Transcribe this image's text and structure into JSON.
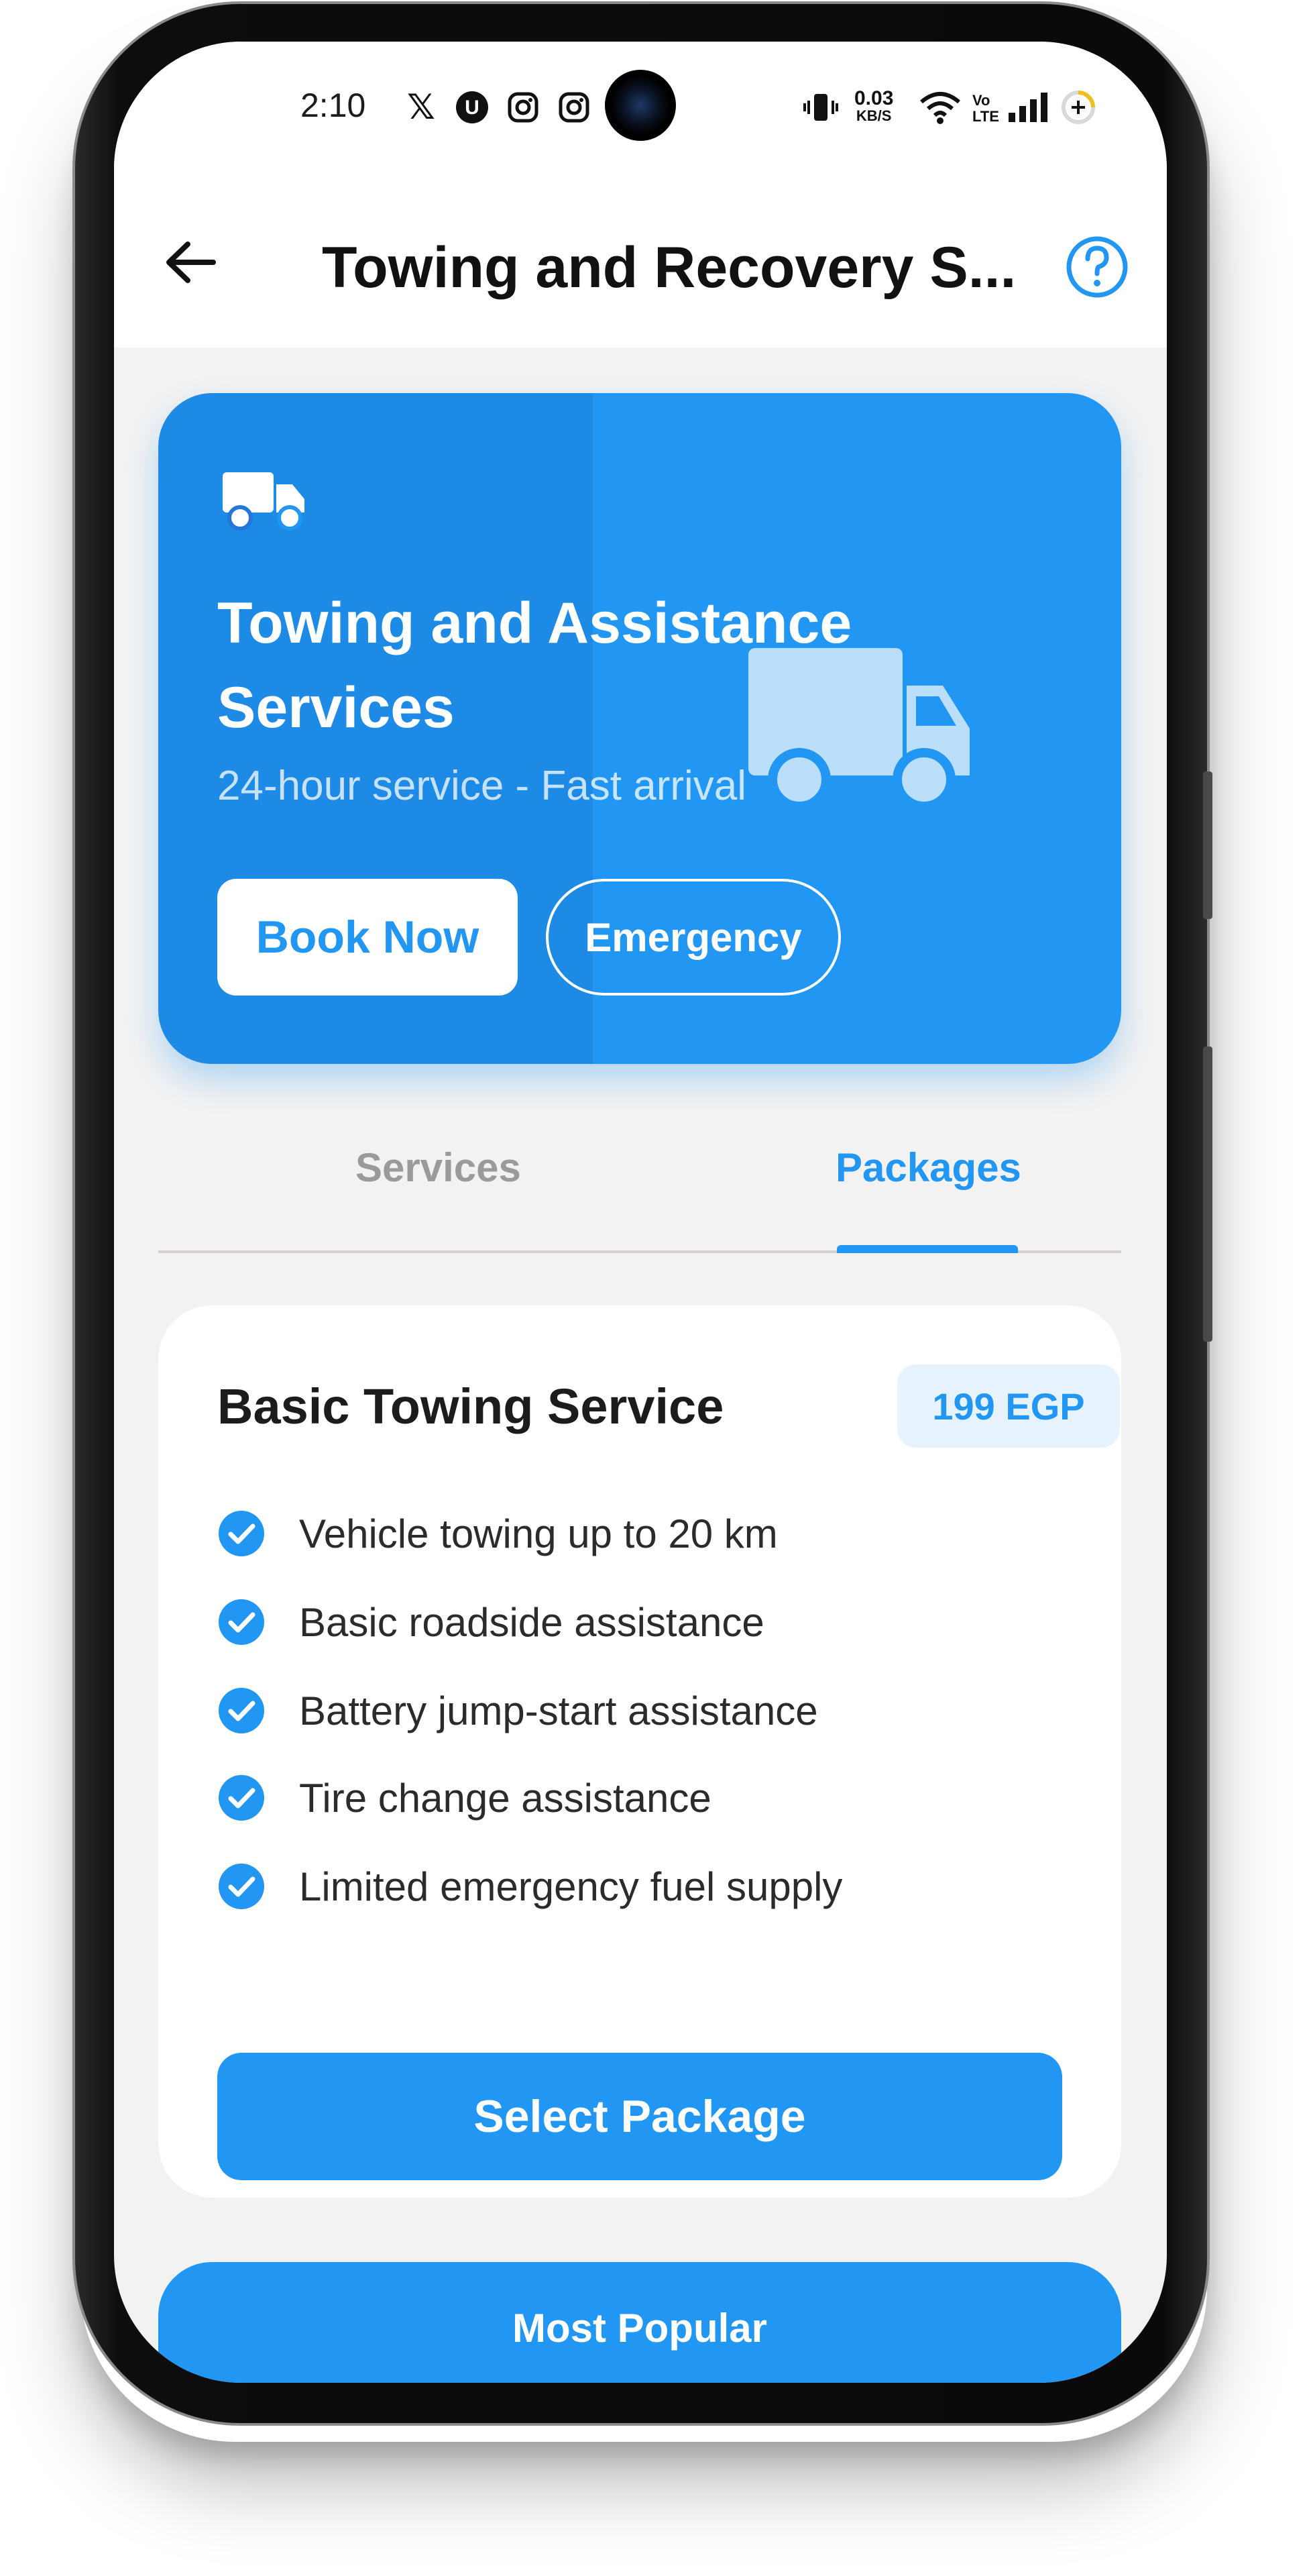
{
  "status_bar": {
    "time": "2:10",
    "net_speed_value": "0.03",
    "net_speed_unit": "KB/S",
    "volte_top": "Vo",
    "volte_bottom": "LTE",
    "icons": [
      "x-icon",
      "u-icon",
      "instagram-icon",
      "instagram-icon",
      "vibrate-icon",
      "wifi-icon",
      "signal-icon",
      "battery-icon"
    ]
  },
  "app_bar": {
    "title": "Towing and Recovery S...",
    "back_icon": "arrow-left-icon",
    "help_icon": "help-circle-icon"
  },
  "hero": {
    "title": "Towing and Assistance Services",
    "subtitle": "24-hour service - Fast arrival",
    "book_label": "Book Now",
    "emergency_label": "Emergency",
    "icon": "truck-icon"
  },
  "tabs": [
    {
      "label": "Services",
      "selected": false
    },
    {
      "label": "Packages",
      "selected": true
    }
  ],
  "package": {
    "title": "Basic Towing Service",
    "price": "199 EGP",
    "features": [
      "Vehicle towing up to 20 km",
      "Basic roadside assistance",
      "Battery jump-start assistance",
      "Tire change assistance",
      "Limited emergency fuel supply"
    ],
    "select_label": "Select Package"
  },
  "next_package": {
    "badge": "Most Popular"
  },
  "colors": {
    "primary": "#2196f3",
    "primary_light": "#e6f2fd",
    "background": "#f2f2f2",
    "text": "#1c1c1c",
    "muted": "#9a9a9a"
  }
}
